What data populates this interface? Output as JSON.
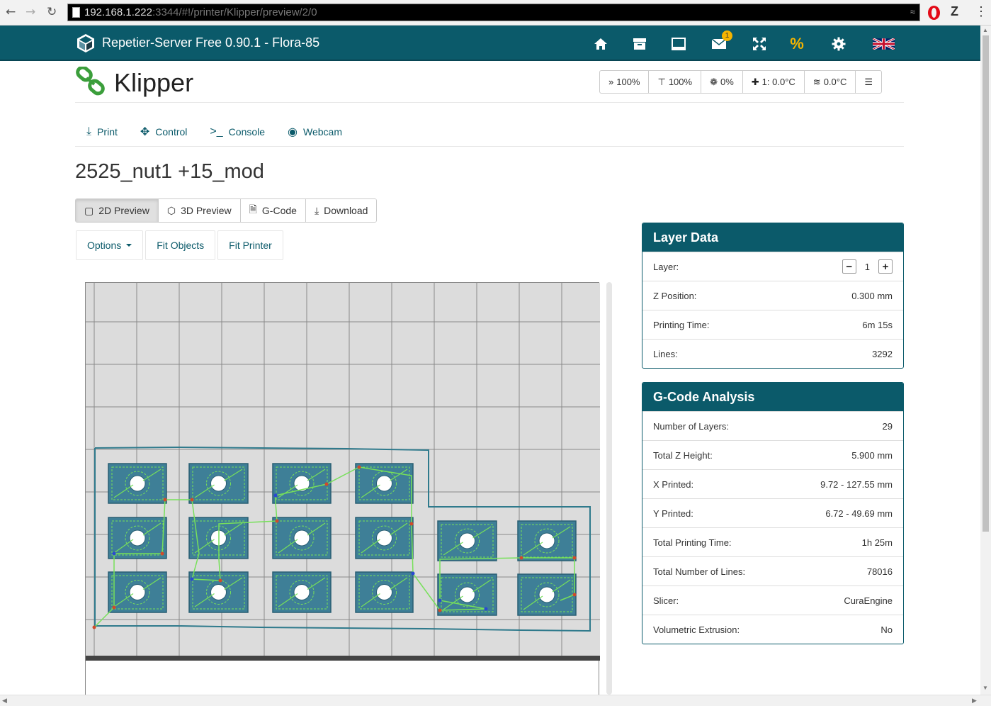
{
  "browser": {
    "url_host": "192.168.1.222",
    "url_rest": ":3344/#!/printer/Klipper/preview/2/0",
    "ext_z": "Z"
  },
  "topbar": {
    "title": "Repetier-Server Free 0.90.1 - Flora-85",
    "messages_badge": "1",
    "icons": [
      "home-icon",
      "archive-icon",
      "book-icon",
      "envelope-icon",
      "fullscreen-icon",
      "percent-icon",
      "gear-icon",
      "uk-flag-icon"
    ]
  },
  "printer": {
    "name": "Klipper"
  },
  "status": {
    "speed": "100%",
    "flow": "100%",
    "fan": "0%",
    "extruder": "1: 0.0°C",
    "bed": "0.0°C"
  },
  "tabs": {
    "print": "Print",
    "control": "Control",
    "console": "Console",
    "webcam": "Webcam"
  },
  "page_title": "2525_nut1 +15_mod",
  "view_buttons": {
    "preview2d": "2D Preview",
    "preview3d": "3D Preview",
    "gcode": "G-Code",
    "download": "Download"
  },
  "options_row": {
    "options": "Options",
    "fit_objects": "Fit Objects",
    "fit_printer": "Fit Printer"
  },
  "layer_data": {
    "title": "Layer Data",
    "layer_label": "Layer:",
    "layer_value": "1",
    "z_label": "Z Position:",
    "z_value": "0.300 mm",
    "time_label": "Printing Time:",
    "time_value": "6m 15s",
    "lines_label": "Lines:",
    "lines_value": "3292"
  },
  "analysis": {
    "title": "G-Code Analysis",
    "rows": [
      {
        "label": "Number of Layers:",
        "value": "29"
      },
      {
        "label": "Total Z Height:",
        "value": "5.900 mm"
      },
      {
        "label": "X Printed:",
        "value": "9.72 - 127.55 mm"
      },
      {
        "label": "Y Printed:",
        "value": "6.72 - 49.69 mm"
      },
      {
        "label": "Total Printing Time:",
        "value": "1h 25m"
      },
      {
        "label": "Total Number of Lines:",
        "value": "78016"
      },
      {
        "label": "Slicer:",
        "value": "CuraEngine"
      },
      {
        "label": "Volumetric Extrusion:",
        "value": "No"
      }
    ]
  },
  "colors": {
    "brand": "#0b5a6a",
    "accent": "#f5b400",
    "part_fill": "#3e7f97",
    "travel": "#77e05a",
    "outline": "#2f7a8c"
  }
}
